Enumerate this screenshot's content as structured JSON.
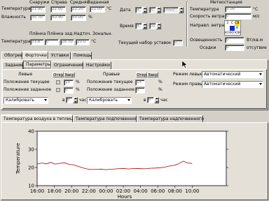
{
  "top": {
    "col_headers": [
      "Снаружи",
      "Справа",
      "Средняя",
      "Заданная"
    ],
    "temp_label": "Температура",
    "temp_values": [
      "21.90",
      "22.00",
      "22.20",
      "21.00"
    ],
    "temp_unit": "°C",
    "hum_label": "Влажность",
    "hum_values": [
      "35.70",
      "50.40",
      "50.00"
    ],
    "hum_unit": "%",
    "date_label": "Дата",
    "date_values": [
      "9",
      "6",
      "2010"
    ],
    "time_label": "Время",
    "time_values": [
      "8",
      "52"
    ],
    "film_header": "Плёнка Плёнка зад.Надточ. Зональн.",
    "film_temp_label": "Температура",
    "film_values": [
      "33.8",
      "0",
      "26.70",
      "20.0"
    ],
    "setpoint_label": "Текущий набор уставок",
    "setpoint_value": "0"
  },
  "meteo": {
    "title": "Метеостанция",
    "temp_label": "Температура",
    "temp_value": "5.00",
    "temp_unit": "°C",
    "wind_label": "Скорость ветра",
    "wind_value": "0",
    "wind_unit": "м/с",
    "dir_label": "Направл. ветра",
    "dir_grid": [
      "3",
      "С",
      "СВ",
      "",
      "",
      "В",
      "ЮЗ",
      "Ю",
      "ЮВ"
    ],
    "light_label": "Освещенность",
    "light_value": "0",
    "light_unit": "Вт/кв.м",
    "rain_label": "Осадки",
    "rain_value": "0",
    "rain_unit": "отсутвие"
  },
  "main_tabs": [
    "Обогрев",
    "Форточки",
    "Уставки",
    "Помощь"
  ],
  "sub_tabs": [
    "Задание",
    "Параметры",
    "Ограничения",
    "Настройки"
  ],
  "vents": {
    "left_title": "Левые",
    "right_title": "Правые",
    "col_open": "Откр",
    "col_close": "Закр",
    "current_label": "Положение текущее",
    "target_label": "Положение заданное",
    "left_current": "10",
    "left_target": "0",
    "right_current": "15",
    "right_target": "0",
    "unit": "%",
    "calibrate_label": "Калибровать",
    "in_label": "в",
    "calibrate_value": "0",
    "hour_label": "час",
    "mode_left_label": "Режим левые",
    "mode_right_label": "Режим правые",
    "mode_left_value": "Автоматический",
    "mode_right_value": "Автоматический"
  },
  "chart_tabs": [
    "Температура воздуха в теплице",
    "Температура подпочвенного",
    "Температура надпочвенного"
  ],
  "chart_data": {
    "type": "line",
    "ylabel": "Temperature",
    "xlabel": "Hours",
    "ylim": [
      10,
      40
    ],
    "yticks": [
      10,
      20,
      30,
      40
    ],
    "xticks": [
      "16:00",
      "18:00",
      "20:00",
      "22:00",
      "00:00",
      "02:00",
      "04:00",
      "06:00",
      "08:00",
      "10:00"
    ],
    "series": [
      {
        "color": "#aa0000",
        "x": [
          0,
          0.5,
          1,
          1.5,
          2,
          2.5,
          3,
          3.5,
          4,
          4.5,
          5,
          5.5,
          6,
          6.5,
          7,
          7.5,
          8,
          8.5,
          9,
          9.5,
          10,
          10.5,
          11,
          11.5,
          12,
          12.5,
          13,
          13.5,
          14,
          14.5,
          15,
          15.5,
          16,
          16.5,
          17
        ],
        "values": [
          21.8,
          22.5,
          22.0,
          22.8,
          21.9,
          22.3,
          22.6,
          21.7,
          21.5,
          20.6,
          19.8,
          19.2,
          18.9,
          19.0,
          19.1,
          18.8,
          19.0,
          19.2,
          19.4,
          19.5,
          19.2,
          19.4,
          19.5,
          19.3,
          19.4,
          19.6,
          19.7,
          19.9,
          20.2,
          20.8,
          21.2,
          22.0,
          23.5,
          22.5,
          22.2
        ]
      }
    ]
  }
}
